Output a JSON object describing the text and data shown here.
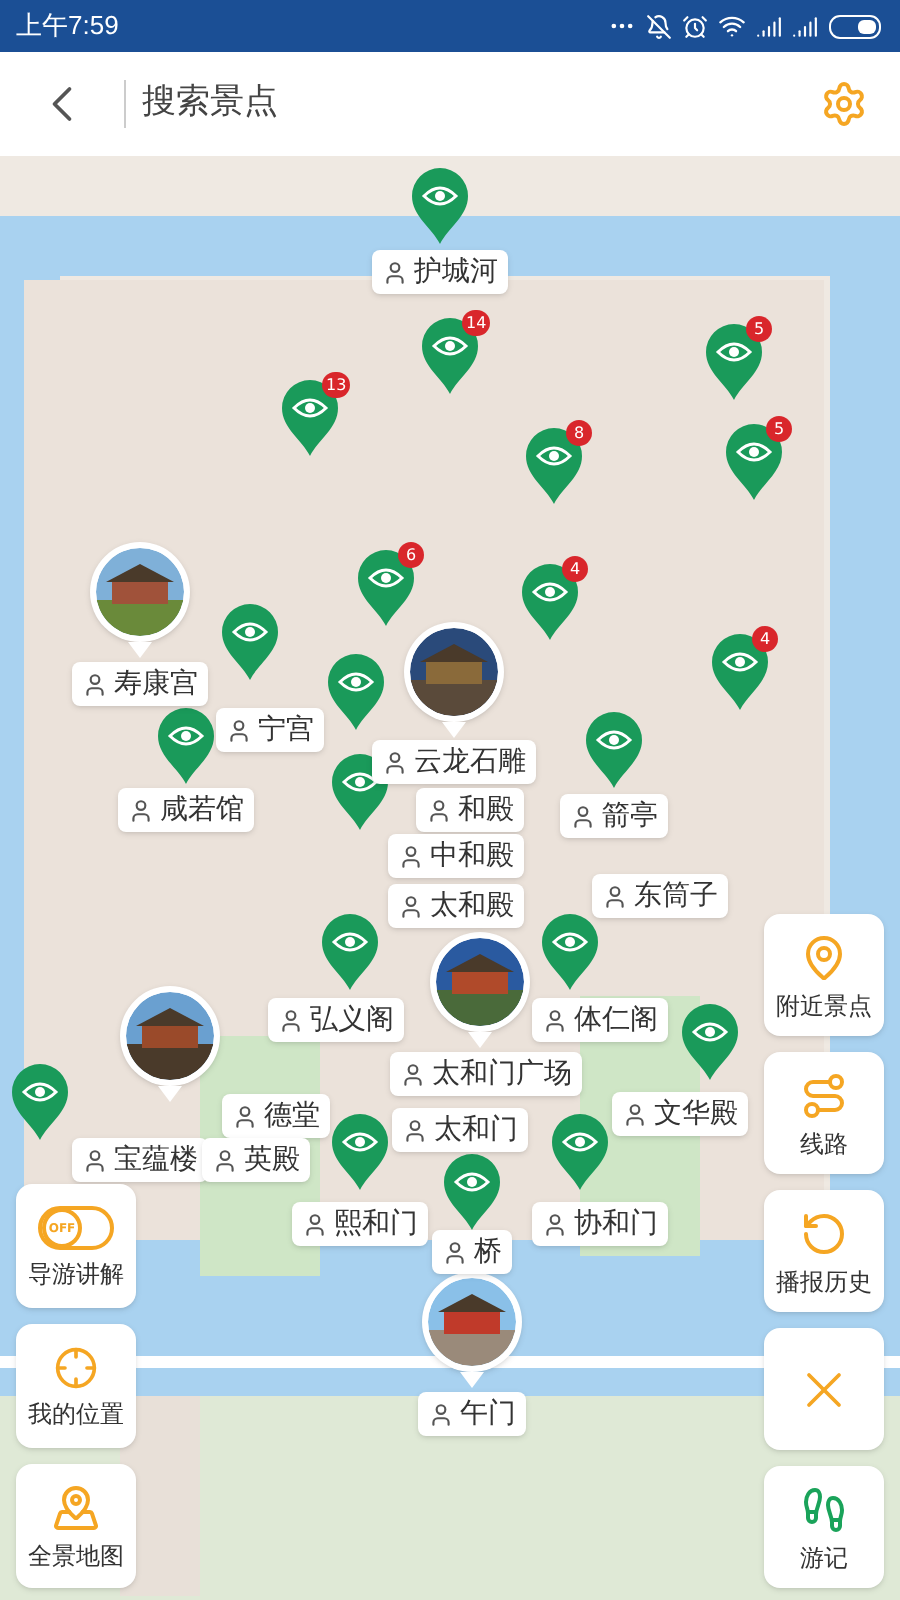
{
  "status_bar": {
    "time": "上午7:59"
  },
  "header": {
    "search_placeholder": "搜索景点"
  },
  "map": {
    "pins": [
      {
        "kind": "plain"
      },
      {
        "kind": "counted",
        "count": "14"
      },
      {
        "kind": "counted",
        "count": "13"
      },
      {
        "kind": "counted",
        "count": "5"
      },
      {
        "kind": "counted",
        "count": "8"
      },
      {
        "kind": "counted",
        "count": "5"
      },
      {
        "kind": "counted",
        "count": "6"
      },
      {
        "kind": "counted",
        "count": "4"
      },
      {
        "kind": "counted",
        "count": "4"
      },
      {
        "kind": "plain"
      },
      {
        "kind": "plain"
      },
      {
        "kind": "plain"
      },
      {
        "kind": "plain"
      },
      {
        "kind": "plain"
      },
      {
        "kind": "plain"
      },
      {
        "kind": "plain"
      },
      {
        "kind": "plain"
      },
      {
        "kind": "plain"
      },
      {
        "kind": "plain"
      },
      {
        "kind": "plain"
      },
      {
        "kind": "plain"
      }
    ],
    "labels": [
      {
        "text": "护城河"
      },
      {
        "text": "宁宫"
      },
      {
        "text": "寿康宫"
      },
      {
        "text": "咸若馆"
      },
      {
        "text": "云龙石雕"
      },
      {
        "text": "和殿"
      },
      {
        "text": "中和殿"
      },
      {
        "text": "箭亭"
      },
      {
        "text": "东筒子"
      },
      {
        "text": "太和殿"
      },
      {
        "text": "弘义阁"
      },
      {
        "text": "体仁阁"
      },
      {
        "text": "太和门广场"
      },
      {
        "text": "德堂"
      },
      {
        "text": "文华殿"
      },
      {
        "text": "宝蕴楼"
      },
      {
        "text": "英殿"
      },
      {
        "text": "太和门"
      },
      {
        "text": "协和门"
      },
      {
        "text": "熙和门"
      },
      {
        "text": "桥"
      },
      {
        "text": "午门"
      }
    ]
  },
  "left_buttons": [
    {
      "kind": "toggle",
      "label": "导游讲解",
      "toggle_text": "OFF",
      "on": false
    },
    {
      "kind": "locate",
      "label": "我的位置"
    },
    {
      "kind": "panorama",
      "label": "全景地图"
    }
  ],
  "right_buttons": [
    {
      "kind": "nearby",
      "label": "附近景点"
    },
    {
      "kind": "route",
      "label": "线路"
    },
    {
      "kind": "history",
      "label": "播报历史"
    },
    {
      "kind": "close"
    },
    {
      "kind": "journal",
      "label": "游记"
    }
  ]
}
